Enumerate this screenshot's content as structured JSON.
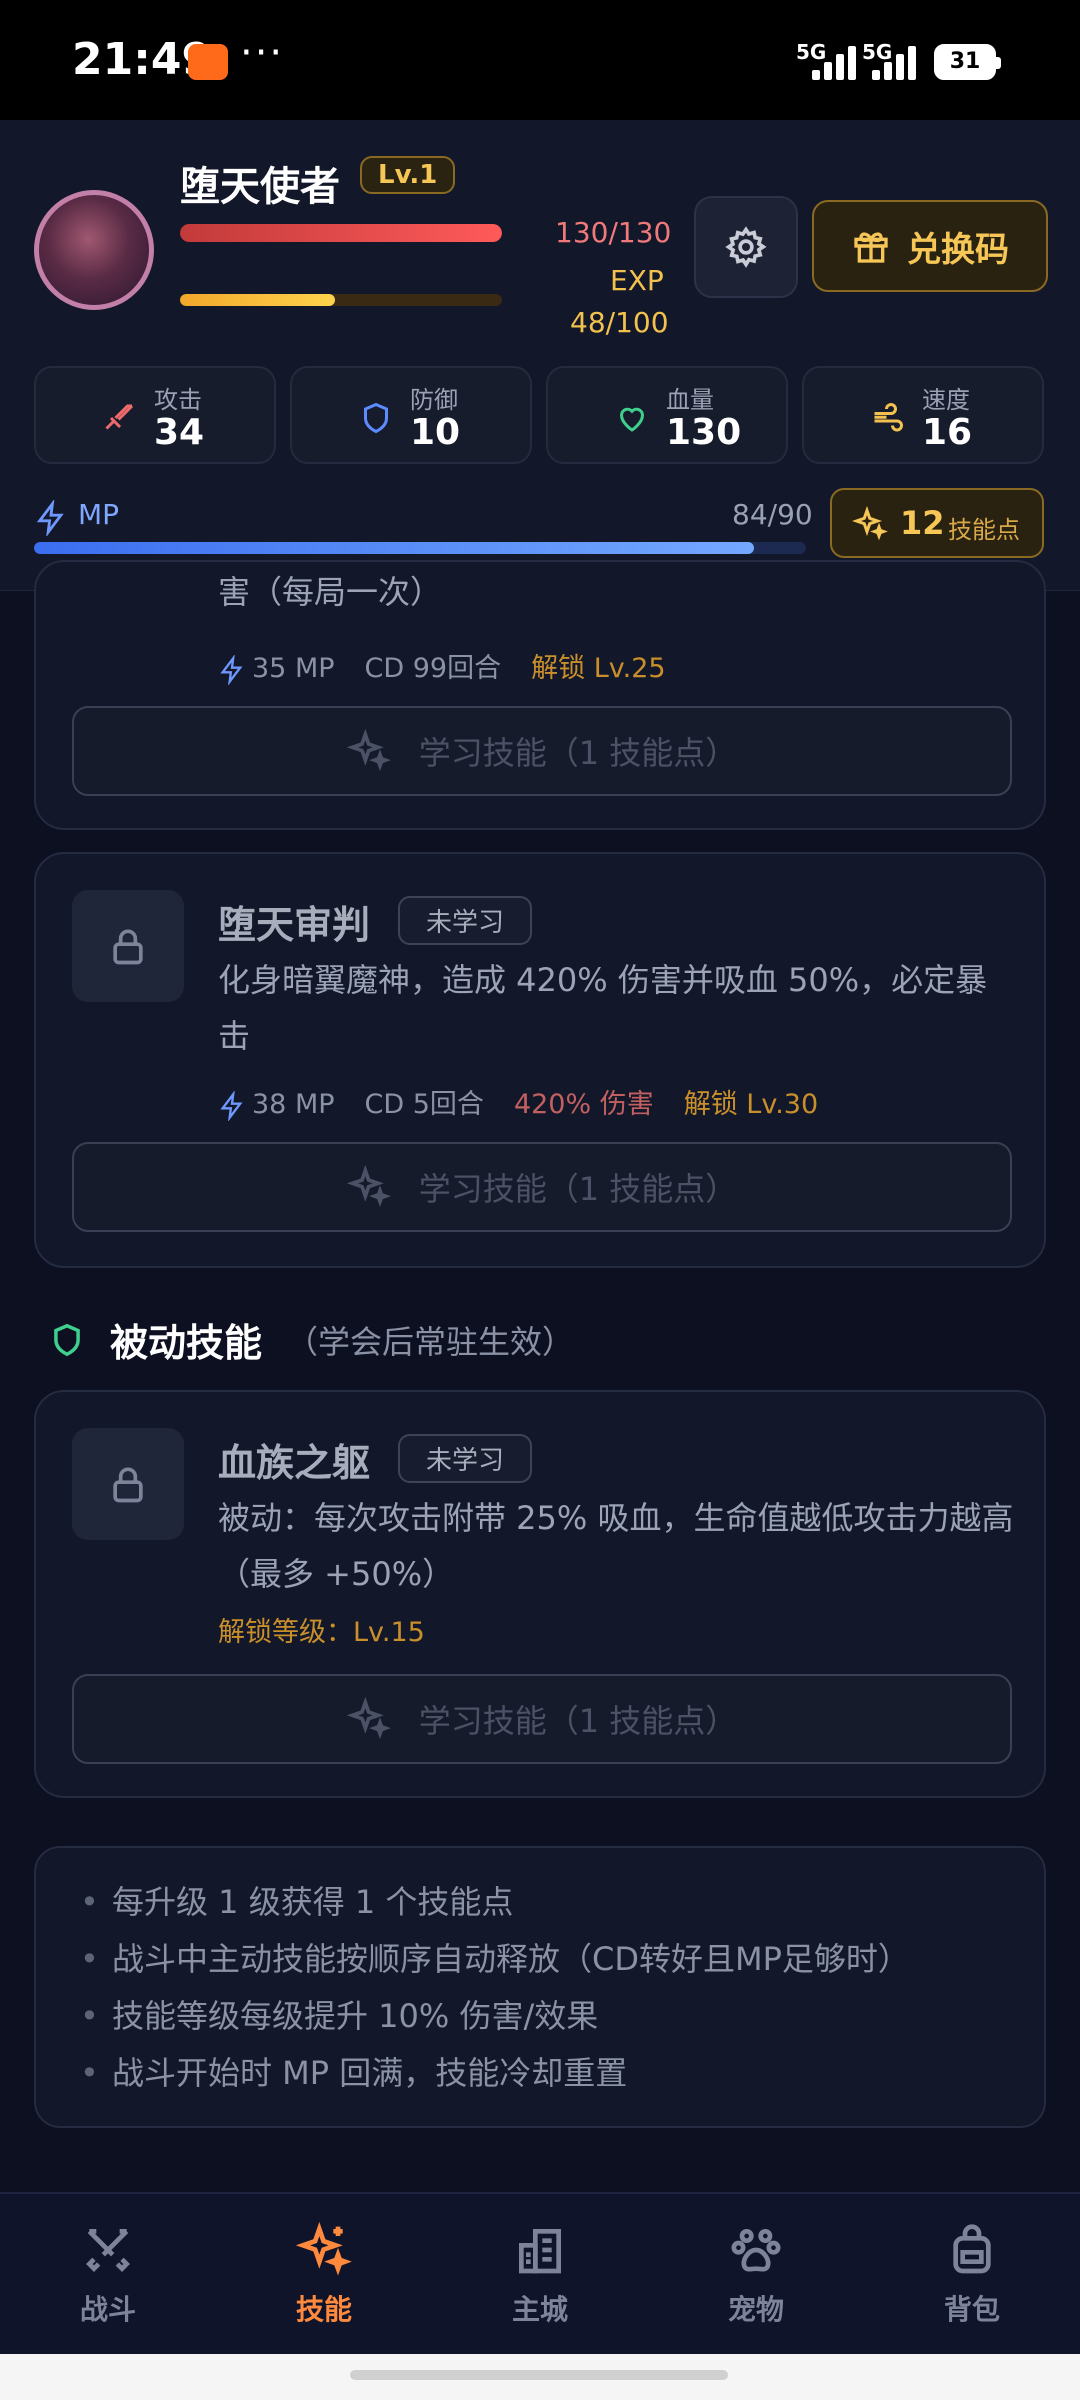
{
  "status_bar": {
    "time": "21:49",
    "dots": "···",
    "sig1": "5G",
    "sig2": "5G",
    "battery": "31"
  },
  "player": {
    "name": "堕天使者",
    "level": "Lv.1",
    "hp_text": "130/130",
    "hp_fraction": 1.0,
    "exp_label": "EXP",
    "exp_text": "48/100",
    "exp_fraction": 0.48
  },
  "redeem_label": "兑换码",
  "stats": [
    {
      "label": "攻击",
      "value": "34",
      "icon": "sword-icon",
      "color": "#ef6b6b"
    },
    {
      "label": "防御",
      "value": "10",
      "icon": "shield-icon",
      "color": "#5c8cff"
    },
    {
      "label": "血量",
      "value": "130",
      "icon": "heart-icon",
      "color": "#3fcf8e"
    },
    {
      "label": "速度",
      "value": "16",
      "icon": "wind-icon",
      "color": "#f2c14e"
    }
  ],
  "mp": {
    "label": "MP",
    "text": "84/90",
    "fraction": 0.933
  },
  "skill_points": {
    "count": "12",
    "label": "技能点"
  },
  "skills": [
    {
      "desc_tail": "害（每局一次）",
      "mp": "35 MP",
      "cd": "CD 99回合",
      "unlock": "解锁 Lv.25",
      "learn_label": "学习技能（1 技能点）"
    },
    {
      "name": "堕天审判",
      "status": "未学习",
      "desc": "化身暗翼魔神，造成 420% 伤害并吸血 50%，必定暴击",
      "mp": "38 MP",
      "cd": "CD 5回合",
      "damage": "420% 伤害",
      "unlock": "解锁 Lv.30",
      "learn_label": "学习技能（1 技能点）"
    }
  ],
  "passive_section": {
    "title": "被动技能",
    "subtitle": "（学会后常驻生效）"
  },
  "passive_skills": [
    {
      "name": "血族之躯",
      "status": "未学习",
      "desc": "被动：每次攻击附带 25% 吸血，生命值越低攻击力越高（最多 +50%）",
      "unlock": "解锁等级：Lv.15",
      "learn_label": "学习技能（1 技能点）"
    }
  ],
  "tips": [
    "每升级 1 级获得 1 个技能点",
    "战斗中主动技能按顺序自动释放（CD转好且MP足够时）",
    "技能等级每级提升 10% 伤害/效果",
    "战斗开始时 MP 回满，技能冷却重置"
  ],
  "nav": [
    {
      "label": "战斗",
      "icon": "battle-swords-icon",
      "active": false
    },
    {
      "label": "技能",
      "icon": "sparkles-icon",
      "active": true
    },
    {
      "label": "主城",
      "icon": "city-icon",
      "active": false
    },
    {
      "label": "宠物",
      "icon": "paw-icon",
      "active": false
    },
    {
      "label": "背包",
      "icon": "backpack-icon",
      "active": false
    }
  ],
  "colors": {
    "accent": "#ff8a3d",
    "gold": "#f6c657",
    "hp": "#ff5a5a",
    "mp": "#4d86ff"
  }
}
